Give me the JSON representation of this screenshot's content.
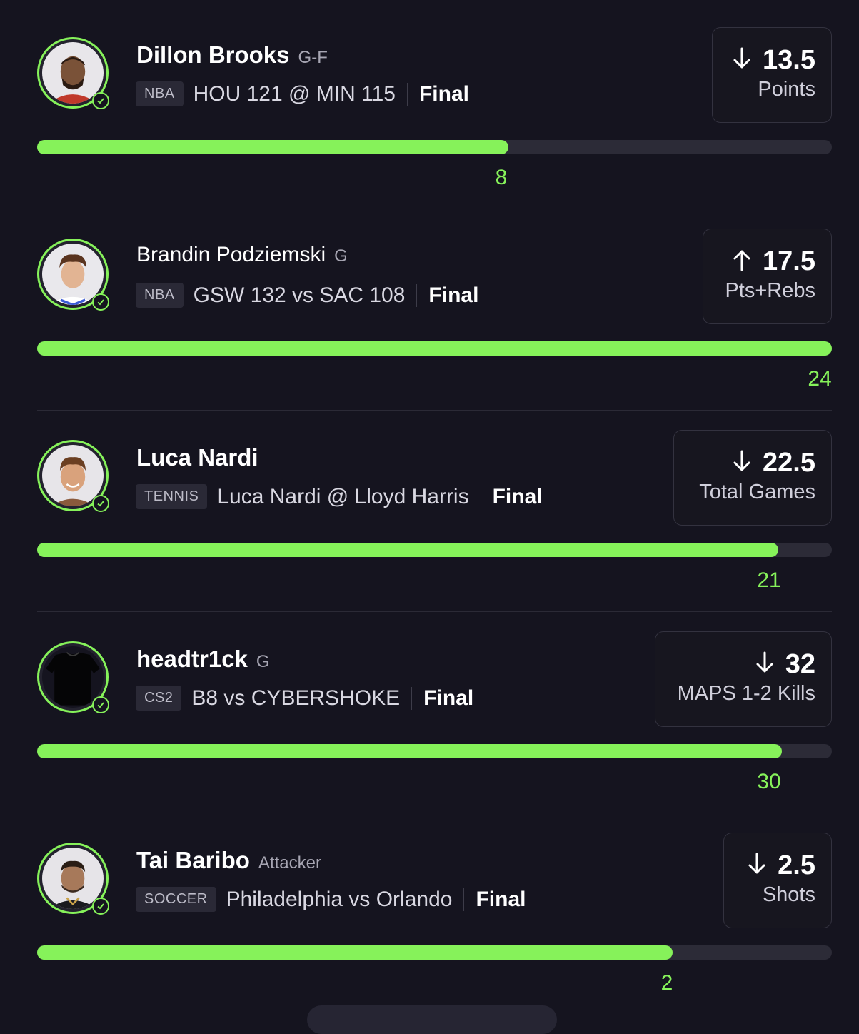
{
  "accent_color": "#86f25a",
  "picks": [
    {
      "player": "Dillon Brooks",
      "position": "G-F",
      "league": "NBA",
      "matchup": "HOU 121 @ MIN 115",
      "status": "Final",
      "direction": "down",
      "line": "13.5",
      "stat": "Points",
      "actual": "8",
      "progress": 0.593
    },
    {
      "player": "Brandin Podziemski",
      "position": "G",
      "league": "NBA",
      "matchup": "GSW 132 vs SAC 108",
      "status": "Final",
      "direction": "up",
      "line": "17.5",
      "stat": "Pts+Rebs",
      "actual": "24",
      "progress": 1.0
    },
    {
      "player": "Luca Nardi",
      "position": "",
      "league": "TENNIS",
      "matchup": "Luca Nardi @ Lloyd Harris",
      "status": "Final",
      "direction": "down",
      "line": "22.5",
      "stat": "Total Games",
      "actual": "21",
      "progress": 0.933
    },
    {
      "player": "headtr1ck",
      "position": "G",
      "league": "CS2",
      "matchup": "B8 vs CYBERSHOKE",
      "status": "Final",
      "direction": "down",
      "line": "32",
      "stat": "MAPS 1-2 Kills",
      "actual": "30",
      "progress": 0.937
    },
    {
      "player": "Tai Baribo",
      "position": "Attacker",
      "league": "SOCCER",
      "matchup": "Philadelphia vs Orlando",
      "status": "Final",
      "direction": "down",
      "line": "2.5",
      "stat": "Shots",
      "actual": "2",
      "progress": 0.8
    }
  ]
}
